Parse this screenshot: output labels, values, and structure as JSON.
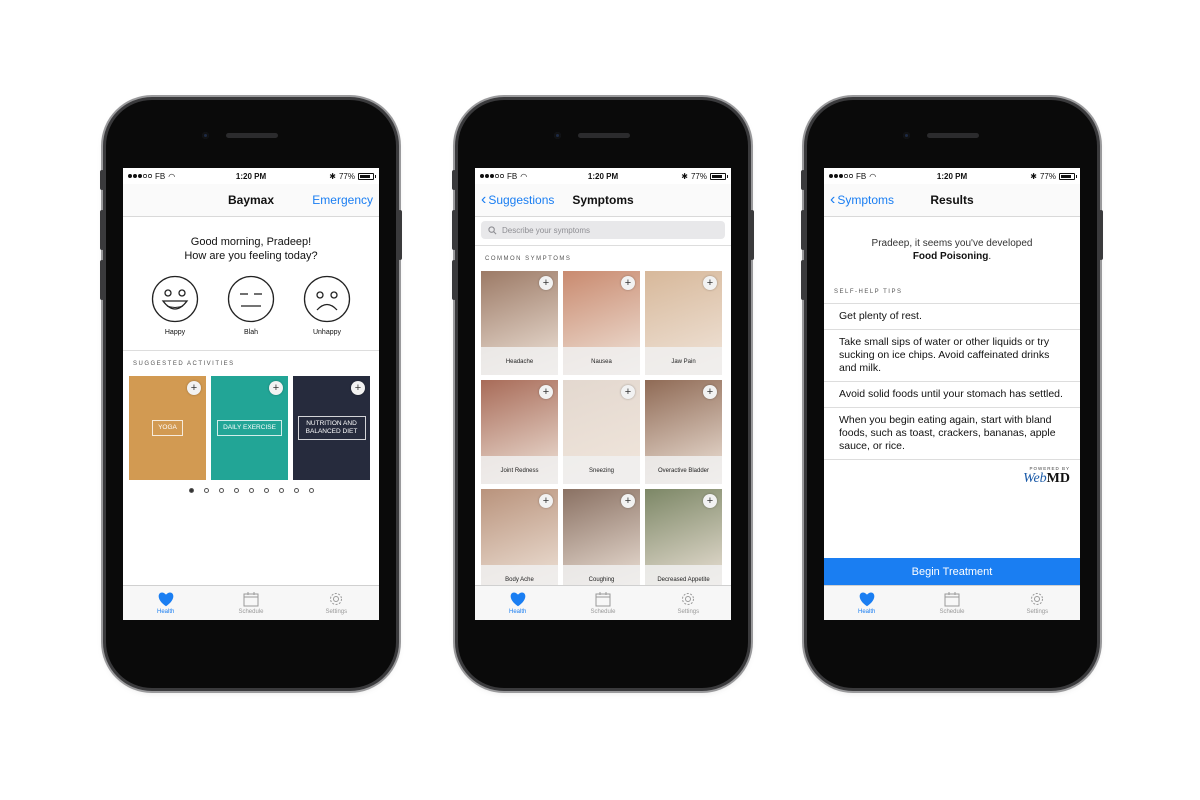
{
  "status": {
    "carrier": "FB",
    "time": "1:20 PM",
    "battery": "77%"
  },
  "tabs": [
    {
      "label": "Health",
      "icon": "heart-icon"
    },
    {
      "label": "Schedule",
      "icon": "calendar-icon"
    },
    {
      "label": "Settings",
      "icon": "gear-icon"
    }
  ],
  "screen1": {
    "title": "Baymax",
    "right_link": "Emergency",
    "greeting_line1": "Good morning, Pradeep!",
    "greeting_line2": "How are you feeling today?",
    "moods": [
      {
        "label": "Happy",
        "icon": "happy-face-icon"
      },
      {
        "label": "Blah",
        "icon": "neutral-face-icon"
      },
      {
        "label": "Unhappy",
        "icon": "sad-face-icon"
      }
    ],
    "section_title": "SUGGESTED ACTIVITIES",
    "activities": [
      {
        "label": "YOGA",
        "color": "#d29a52"
      },
      {
        "label": "DAILY EXERCISE",
        "color": "#22a596"
      },
      {
        "label": "NUTRITION AND BALANCED DIET",
        "color": "#262b3d"
      }
    ],
    "page_count": 9,
    "page_active": 1
  },
  "screen2": {
    "back": "Suggestions",
    "title": "Symptoms",
    "search_placeholder": "Describe your symptoms",
    "section_title": "COMMON SYMPTOMS",
    "symptoms": [
      {
        "label": "Headache",
        "color": "#9c7a66"
      },
      {
        "label": "Nausea",
        "color": "#c98a6f"
      },
      {
        "label": "Jaw Pain",
        "color": "#d7b89a"
      },
      {
        "label": "Joint Redness",
        "color": "#a86b58"
      },
      {
        "label": "Sneezing",
        "color": "#e3d8cf"
      },
      {
        "label": "Overactive Bladder",
        "color": "#8f6a55"
      },
      {
        "label": "Body Ache",
        "color": "#b9937c"
      },
      {
        "label": "Coughing",
        "color": "#8a7163"
      },
      {
        "label": "Decreased Appetite",
        "color": "#7c8766"
      }
    ]
  },
  "screen3": {
    "back": "Symptoms",
    "title": "Results",
    "message_prefix": "Pradeep, it seems you've developed",
    "diagnosis": "Food Poisoning",
    "section_title": "SELF-HELP TIPS",
    "tips": [
      "Get plenty of rest.",
      "Take small sips of water or other liquids or try sucking on ice chips. Avoid caffeinated drinks and milk.",
      "Avoid solid foods until your stomach has settled.",
      "When you begin eating again, start with bland foods, such as toast, crackers, bananas, apple sauce, or rice."
    ],
    "powered_by": "POWERED BY",
    "webmd_part1": "Web",
    "webmd_part2": "MD",
    "button": "Begin Treatment"
  },
  "colors": {
    "accent": "#1a7ef2"
  }
}
